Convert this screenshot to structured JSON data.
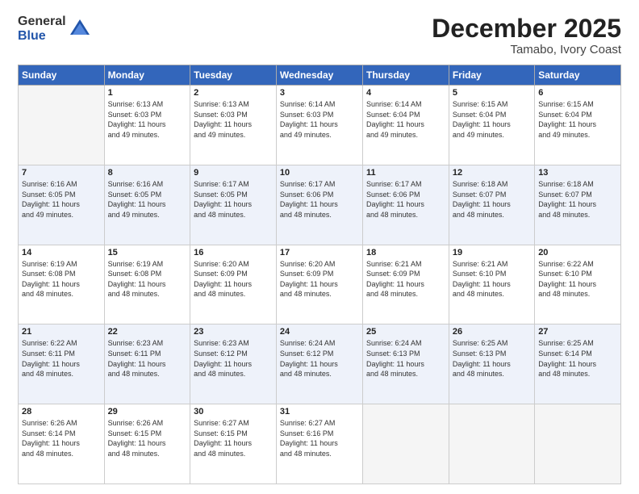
{
  "logo": {
    "general": "General",
    "blue": "Blue"
  },
  "header": {
    "month": "December 2025",
    "location": "Tamabo, Ivory Coast"
  },
  "weekdays": [
    "Sunday",
    "Monday",
    "Tuesday",
    "Wednesday",
    "Thursday",
    "Friday",
    "Saturday"
  ],
  "weeks": [
    [
      {
        "day": "",
        "sunrise": "",
        "sunset": "",
        "daylight": ""
      },
      {
        "day": "1",
        "sunrise": "Sunrise: 6:13 AM",
        "sunset": "Sunset: 6:03 PM",
        "daylight": "Daylight: 11 hours and 49 minutes."
      },
      {
        "day": "2",
        "sunrise": "Sunrise: 6:13 AM",
        "sunset": "Sunset: 6:03 PM",
        "daylight": "Daylight: 11 hours and 49 minutes."
      },
      {
        "day": "3",
        "sunrise": "Sunrise: 6:14 AM",
        "sunset": "Sunset: 6:03 PM",
        "daylight": "Daylight: 11 hours and 49 minutes."
      },
      {
        "day": "4",
        "sunrise": "Sunrise: 6:14 AM",
        "sunset": "Sunset: 6:04 PM",
        "daylight": "Daylight: 11 hours and 49 minutes."
      },
      {
        "day": "5",
        "sunrise": "Sunrise: 6:15 AM",
        "sunset": "Sunset: 6:04 PM",
        "daylight": "Daylight: 11 hours and 49 minutes."
      },
      {
        "day": "6",
        "sunrise": "Sunrise: 6:15 AM",
        "sunset": "Sunset: 6:04 PM",
        "daylight": "Daylight: 11 hours and 49 minutes."
      }
    ],
    [
      {
        "day": "7",
        "sunrise": "Sunrise: 6:16 AM",
        "sunset": "Sunset: 6:05 PM",
        "daylight": "Daylight: 11 hours and 49 minutes."
      },
      {
        "day": "8",
        "sunrise": "Sunrise: 6:16 AM",
        "sunset": "Sunset: 6:05 PM",
        "daylight": "Daylight: 11 hours and 49 minutes."
      },
      {
        "day": "9",
        "sunrise": "Sunrise: 6:17 AM",
        "sunset": "Sunset: 6:05 PM",
        "daylight": "Daylight: 11 hours and 48 minutes."
      },
      {
        "day": "10",
        "sunrise": "Sunrise: 6:17 AM",
        "sunset": "Sunset: 6:06 PM",
        "daylight": "Daylight: 11 hours and 48 minutes."
      },
      {
        "day": "11",
        "sunrise": "Sunrise: 6:17 AM",
        "sunset": "Sunset: 6:06 PM",
        "daylight": "Daylight: 11 hours and 48 minutes."
      },
      {
        "day": "12",
        "sunrise": "Sunrise: 6:18 AM",
        "sunset": "Sunset: 6:07 PM",
        "daylight": "Daylight: 11 hours and 48 minutes."
      },
      {
        "day": "13",
        "sunrise": "Sunrise: 6:18 AM",
        "sunset": "Sunset: 6:07 PM",
        "daylight": "Daylight: 11 hours and 48 minutes."
      }
    ],
    [
      {
        "day": "14",
        "sunrise": "Sunrise: 6:19 AM",
        "sunset": "Sunset: 6:08 PM",
        "daylight": "Daylight: 11 hours and 48 minutes."
      },
      {
        "day": "15",
        "sunrise": "Sunrise: 6:19 AM",
        "sunset": "Sunset: 6:08 PM",
        "daylight": "Daylight: 11 hours and 48 minutes."
      },
      {
        "day": "16",
        "sunrise": "Sunrise: 6:20 AM",
        "sunset": "Sunset: 6:09 PM",
        "daylight": "Daylight: 11 hours and 48 minutes."
      },
      {
        "day": "17",
        "sunrise": "Sunrise: 6:20 AM",
        "sunset": "Sunset: 6:09 PM",
        "daylight": "Daylight: 11 hours and 48 minutes."
      },
      {
        "day": "18",
        "sunrise": "Sunrise: 6:21 AM",
        "sunset": "Sunset: 6:09 PM",
        "daylight": "Daylight: 11 hours and 48 minutes."
      },
      {
        "day": "19",
        "sunrise": "Sunrise: 6:21 AM",
        "sunset": "Sunset: 6:10 PM",
        "daylight": "Daylight: 11 hours and 48 minutes."
      },
      {
        "day": "20",
        "sunrise": "Sunrise: 6:22 AM",
        "sunset": "Sunset: 6:10 PM",
        "daylight": "Daylight: 11 hours and 48 minutes."
      }
    ],
    [
      {
        "day": "21",
        "sunrise": "Sunrise: 6:22 AM",
        "sunset": "Sunset: 6:11 PM",
        "daylight": "Daylight: 11 hours and 48 minutes."
      },
      {
        "day": "22",
        "sunrise": "Sunrise: 6:23 AM",
        "sunset": "Sunset: 6:11 PM",
        "daylight": "Daylight: 11 hours and 48 minutes."
      },
      {
        "day": "23",
        "sunrise": "Sunrise: 6:23 AM",
        "sunset": "Sunset: 6:12 PM",
        "daylight": "Daylight: 11 hours and 48 minutes."
      },
      {
        "day": "24",
        "sunrise": "Sunrise: 6:24 AM",
        "sunset": "Sunset: 6:12 PM",
        "daylight": "Daylight: 11 hours and 48 minutes."
      },
      {
        "day": "25",
        "sunrise": "Sunrise: 6:24 AM",
        "sunset": "Sunset: 6:13 PM",
        "daylight": "Daylight: 11 hours and 48 minutes."
      },
      {
        "day": "26",
        "sunrise": "Sunrise: 6:25 AM",
        "sunset": "Sunset: 6:13 PM",
        "daylight": "Daylight: 11 hours and 48 minutes."
      },
      {
        "day": "27",
        "sunrise": "Sunrise: 6:25 AM",
        "sunset": "Sunset: 6:14 PM",
        "daylight": "Daylight: 11 hours and 48 minutes."
      }
    ],
    [
      {
        "day": "28",
        "sunrise": "Sunrise: 6:26 AM",
        "sunset": "Sunset: 6:14 PM",
        "daylight": "Daylight: 11 hours and 48 minutes."
      },
      {
        "day": "29",
        "sunrise": "Sunrise: 6:26 AM",
        "sunset": "Sunset: 6:15 PM",
        "daylight": "Daylight: 11 hours and 48 minutes."
      },
      {
        "day": "30",
        "sunrise": "Sunrise: 6:27 AM",
        "sunset": "Sunset: 6:15 PM",
        "daylight": "Daylight: 11 hours and 48 minutes."
      },
      {
        "day": "31",
        "sunrise": "Sunrise: 6:27 AM",
        "sunset": "Sunset: 6:16 PM",
        "daylight": "Daylight: 11 hours and 48 minutes."
      },
      {
        "day": "",
        "sunrise": "",
        "sunset": "",
        "daylight": ""
      },
      {
        "day": "",
        "sunrise": "",
        "sunset": "",
        "daylight": ""
      },
      {
        "day": "",
        "sunrise": "",
        "sunset": "",
        "daylight": ""
      }
    ]
  ]
}
